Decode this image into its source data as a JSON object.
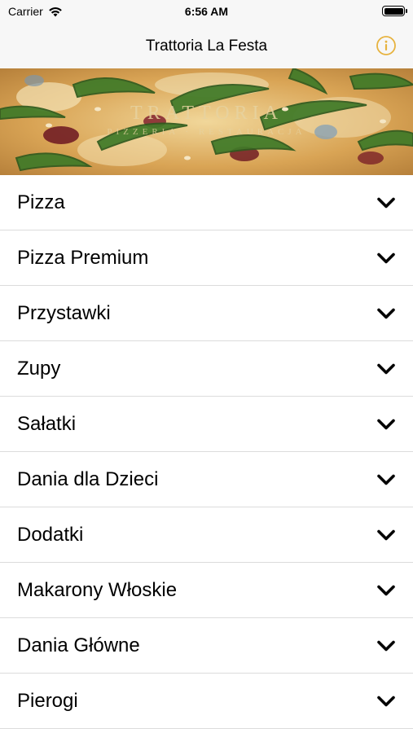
{
  "status_bar": {
    "carrier": "Carrier",
    "time": "6:56 AM"
  },
  "nav": {
    "title": "Trattoria La Festa",
    "info_icon": "info-circle-icon",
    "accent_color": "#e7b33f"
  },
  "hero": {
    "brand": "TRATTORIA",
    "sub": "PIZZERIA · RESTAURACJA"
  },
  "menu": {
    "items": [
      {
        "label": "Pizza"
      },
      {
        "label": "Pizza Premium"
      },
      {
        "label": "Przystawki"
      },
      {
        "label": "Zupy"
      },
      {
        "label": "Sałatki"
      },
      {
        "label": "Dania dla Dzieci"
      },
      {
        "label": "Dodatki"
      },
      {
        "label": "Makarony Włoskie"
      },
      {
        "label": "Dania Główne"
      },
      {
        "label": "Pierogi"
      }
    ],
    "expand_icon": "chevron-down-icon"
  }
}
